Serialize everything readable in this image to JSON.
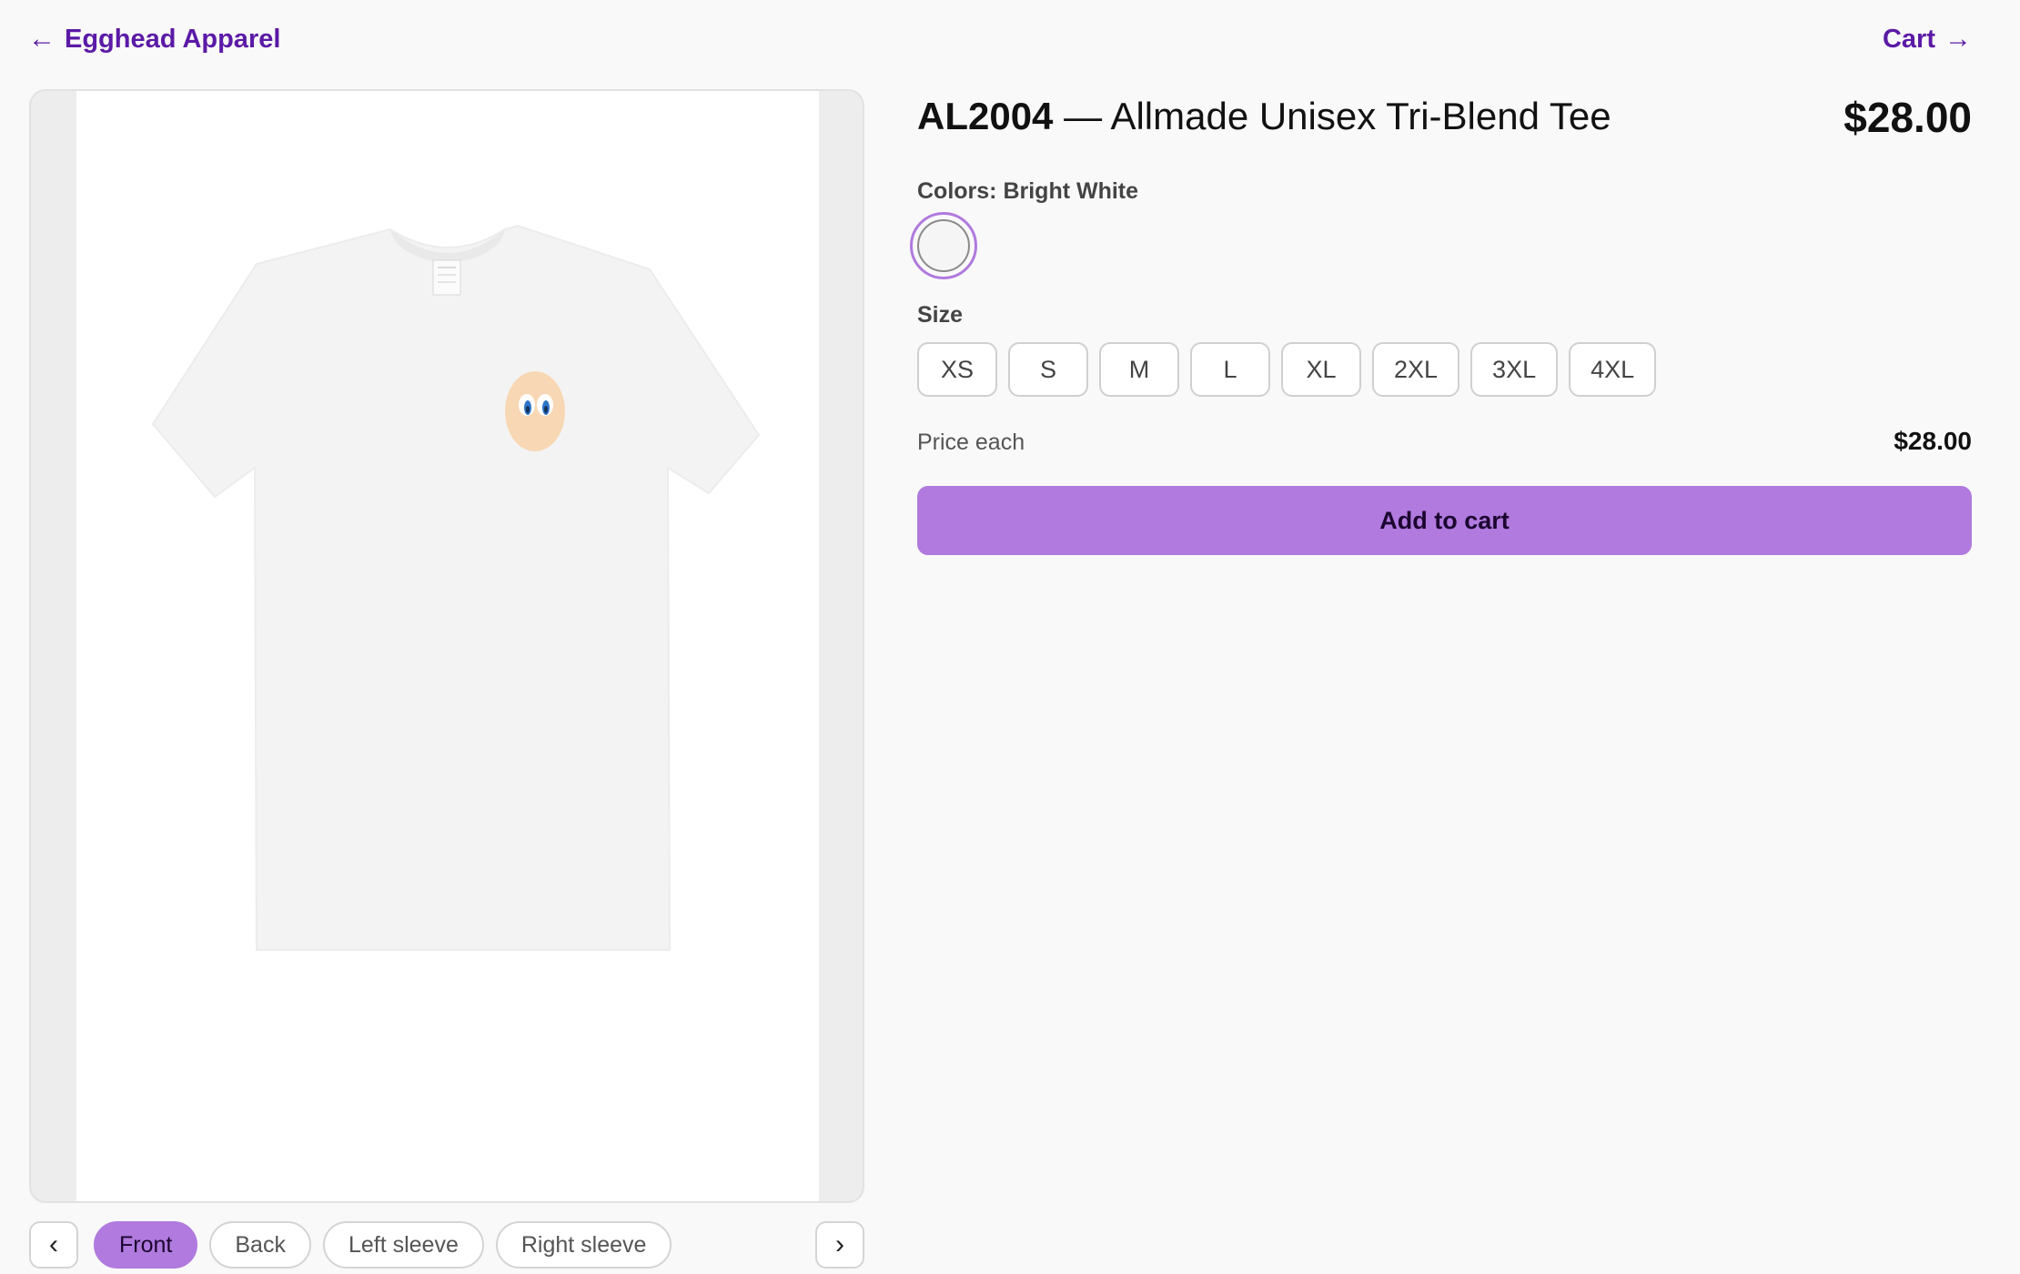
{
  "header": {
    "back_label": "Egghead Apparel",
    "cart_label": "Cart"
  },
  "product": {
    "sku": "AL2004",
    "name": "— Allmade Unisex Tri-Blend Tee",
    "price": "$28.00"
  },
  "colors": {
    "label": "Colors: Bright White",
    "swatches": [
      {
        "name": "Bright White",
        "hex": "#f5f5f5",
        "selected": true
      }
    ]
  },
  "size": {
    "label": "Size",
    "options": [
      "XS",
      "S",
      "M",
      "L",
      "XL",
      "2XL",
      "3XL",
      "4XL"
    ]
  },
  "pricing": {
    "label": "Price each",
    "value": "$28.00"
  },
  "actions": {
    "add_to_cart": "Add to cart"
  },
  "viewer": {
    "prev_icon": "chevron-left-icon",
    "next_icon": "chevron-right-icon",
    "views": [
      "Front",
      "Back",
      "Left sleeve",
      "Right sleeve"
    ],
    "active_view": "Front"
  },
  "colors_theme": {
    "accent": "#b07ade",
    "link": "#5b1aa6"
  }
}
